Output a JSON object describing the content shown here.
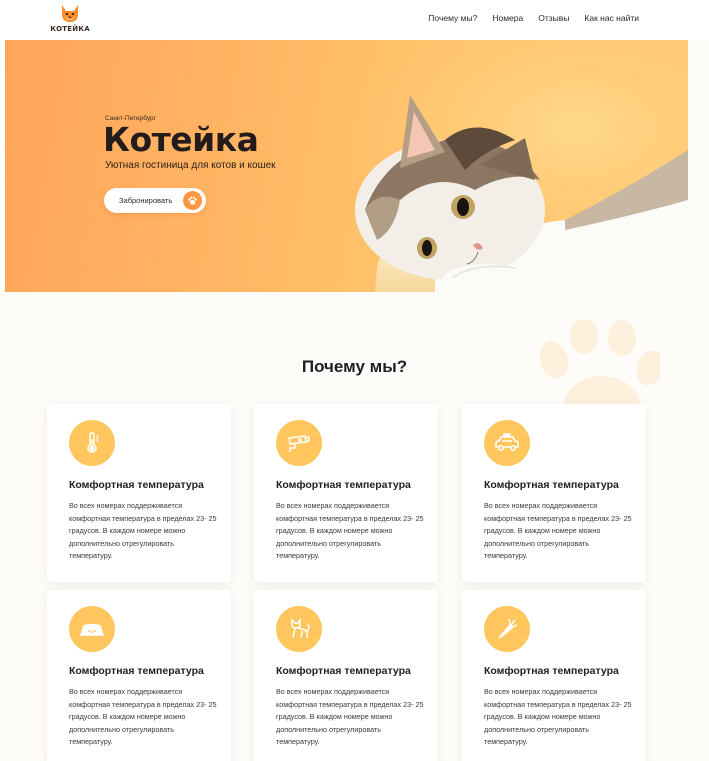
{
  "header": {
    "logo_text": "КОТЕЙКА",
    "nav": [
      {
        "label": "Почему мы?"
      },
      {
        "label": "Номера"
      },
      {
        "label": "Отзывы"
      },
      {
        "label": "Как нас найти"
      }
    ]
  },
  "hero": {
    "city": "Санкт-Петербург",
    "title": "Котейка",
    "subtitle": "Уютная гостиница для котов и кошек",
    "cta": "Забронировать"
  },
  "why": {
    "title": "Почему мы?",
    "cards": [
      {
        "icon": "thermometer-icon",
        "title": "Комфортная температура",
        "text": "Во всех номерах поддерживается комфортная температура в пределах 23- 25 градусов. В каждом номере можно дополнительно отрегулировать температуру."
      },
      {
        "icon": "camera-icon",
        "title": "Комфортная температура",
        "text": "Во всех номерах поддерживается комфортная температура в пределах 23- 25 градусов. В каждом номере можно дополнительно отрегулировать температуру."
      },
      {
        "icon": "taxi-icon",
        "title": "Комфортная температура",
        "text": "Во всех номерах поддерживается комфортная температура в пределах 23- 25 градусов. В каждом номере можно дополнительно отрегулировать температуру."
      },
      {
        "icon": "food-bowl-icon",
        "title": "Комфортная температура",
        "text": "Во всех номерах поддерживается комфортная температура в пределах 23- 25 градусов. В каждом номере можно дополнительно отрегулировать температуру."
      },
      {
        "icon": "cat-icon",
        "title": "Комфортная температура",
        "text": "Во всех номерах поддерживается комфортная температура в пределах 23- 25 градусов. В каждом номере можно дополнительно отрегулировать температуру."
      },
      {
        "icon": "carrot-toy-icon",
        "title": "Комфортная температура",
        "text": "Во всех номерах поддерживается комфортная температура в пределах 23- 25 градусов. В каждом номере можно дополнительно отрегулировать температуру."
      }
    ]
  },
  "colors": {
    "accent": "#ffc65e",
    "hero_orange": "#ffa55a",
    "cta_icon": "#ff9640",
    "paw_watermark": "#fdf0dd"
  }
}
